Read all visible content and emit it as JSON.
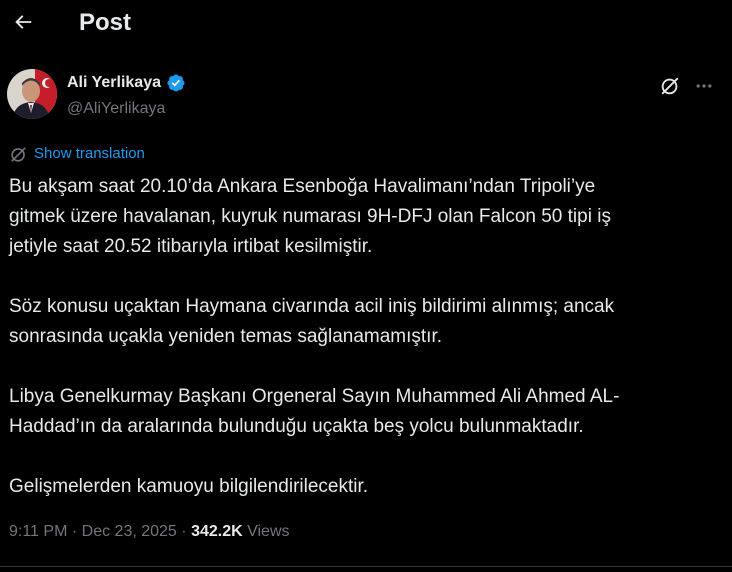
{
  "header": {
    "title": "Post"
  },
  "author": {
    "name": "Ali Yerlikaya",
    "handle": "@AliYerlikaya",
    "verified_color": "#1d9bf0"
  },
  "translate": {
    "label": "Show translation"
  },
  "tweet": {
    "paragraphs": [
      "Bu akşam saat 20.10’da Ankara Esenboğa Havalimanı’ndan Tripoli’ye\ngitmek üzere havalanan, kuyruk numarası 9H-DFJ olan Falcon 50 tipi iş\njetiyle saat 20.52 itibarıyla irtibat kesilmiştir.",
      "Söz konusu uçaktan Haymana civarında acil iniş bildirimi alınmış; ancak\nsonrasında uçakla yeniden temas sağlanamamıştır.",
      "Libya Genelkurmay Başkanı Orgeneral Sayın Muhammed Ali Ahmed AL-\nHaddad’ın da aralarında bulunduğu uçakta beş yolcu bulunmaktadır.",
      "Gelişmelerden kamuoyu bilgilendirilecektir."
    ]
  },
  "meta": {
    "time": "9:11 PM",
    "separator": "·",
    "date": "Dec 23, 2025",
    "views_count": "342.2K",
    "views_label": "Views"
  },
  "colors": {
    "background": "#000000",
    "text": "#e7e9ea",
    "secondary": "#71767b",
    "link": "#1d9bf0"
  },
  "icons": {
    "back": "arrow-left-icon",
    "verified": "verified-badge-icon",
    "grok": "grok-icon",
    "more": "more-horizontal-icon",
    "translate": "globe-translate-icon"
  }
}
